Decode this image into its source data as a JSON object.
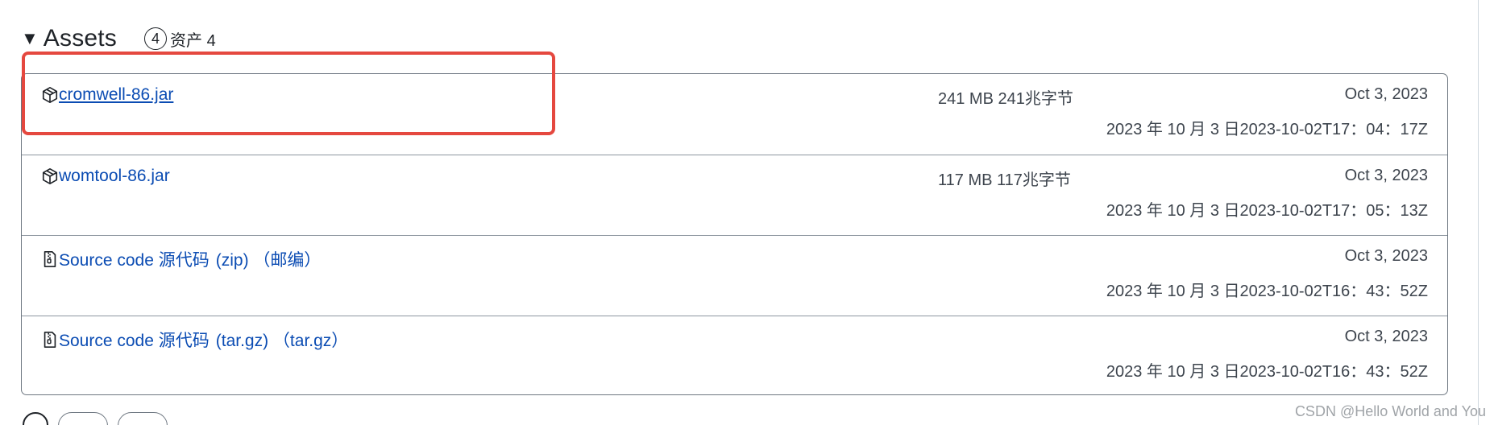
{
  "assets": {
    "title": "Assets",
    "count": "4",
    "count_label": "资产 4",
    "items": [
      {
        "name": "cromwell-86.jar",
        "icon": "package-icon",
        "suffix": "",
        "size": "241 MB 241兆字节",
        "date": "Oct 3, 2023",
        "timestamp": "2023 年 10 月 3 日2023-10-02T17：04：17Z"
      },
      {
        "name": "womtool-86.jar",
        "icon": "package-icon",
        "suffix": "",
        "size": "117 MB 117兆字节",
        "date": "Oct 3, 2023",
        "timestamp": "2023 年 10 月 3 日2023-10-02T17：05：13Z"
      },
      {
        "name": "Source code 源代码",
        "icon": "file-zip-icon",
        "suffix": "(zip) （邮编）",
        "size": "",
        "date": "Oct 3, 2023",
        "timestamp": "2023 年 10 月 3 日2023-10-02T16：43：52Z"
      },
      {
        "name": "Source code 源代码",
        "icon": "file-zip-icon",
        "suffix": "(tar.gz) （tar.gz）",
        "size": "",
        "date": "Oct 3, 2023",
        "timestamp": "2023 年 10 月 3 日2023-10-02T16：43：52Z"
      }
    ]
  },
  "watermark": "CSDN @Hello World and You",
  "colors": {
    "link": "#0b4cb3",
    "highlight": "#e5483f",
    "border": "#6e7781",
    "muted_text": "#3d444d"
  }
}
